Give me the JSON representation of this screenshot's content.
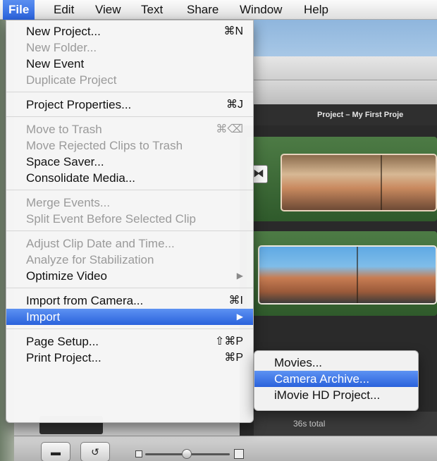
{
  "menubar": {
    "items": [
      "File",
      "Edit",
      "View",
      "Text",
      "Share",
      "Window",
      "Help"
    ],
    "active": "File"
  },
  "file_menu": {
    "groups": [
      [
        {
          "label": "New Project...",
          "shortcut": "⌘N",
          "enabled": true
        },
        {
          "label": "New Folder...",
          "shortcut": "",
          "enabled": false
        },
        {
          "label": "New Event",
          "shortcut": "",
          "enabled": true
        },
        {
          "label": "Duplicate Project",
          "shortcut": "",
          "enabled": false
        }
      ],
      [
        {
          "label": "Project Properties...",
          "shortcut": "⌘J",
          "enabled": true
        }
      ],
      [
        {
          "label": "Move to Trash",
          "shortcut": "⌘⌫",
          "enabled": false
        },
        {
          "label": "Move Rejected Clips to Trash",
          "shortcut": "",
          "enabled": false
        },
        {
          "label": "Space Saver...",
          "shortcut": "",
          "enabled": true
        },
        {
          "label": "Consolidate Media...",
          "shortcut": "",
          "enabled": true
        }
      ],
      [
        {
          "label": "Merge Events...",
          "shortcut": "",
          "enabled": false
        },
        {
          "label": "Split Event Before Selected Clip",
          "shortcut": "",
          "enabled": false
        }
      ],
      [
        {
          "label": "Adjust Clip Date and Time...",
          "shortcut": "",
          "enabled": false
        },
        {
          "label": "Analyze for Stabilization",
          "shortcut": "",
          "enabled": false
        },
        {
          "label": "Optimize Video",
          "shortcut": "",
          "enabled": true,
          "submenu": true
        }
      ],
      [
        {
          "label": "Import from Camera...",
          "shortcut": "⌘I",
          "enabled": true
        },
        {
          "label": "Import",
          "shortcut": "",
          "enabled": true,
          "submenu": true,
          "highlighted": true
        }
      ],
      [
        {
          "label": "Page Setup...",
          "shortcut": "⇧⌘P",
          "enabled": true
        },
        {
          "label": "Print Project...",
          "shortcut": "⌘P",
          "enabled": true
        }
      ]
    ]
  },
  "import_submenu": {
    "items": [
      {
        "label": "Movies...",
        "highlighted": false
      },
      {
        "label": "Camera Archive...",
        "highlighted": true
      },
      {
        "label": "iMovie HD Project...",
        "highlighted": false
      }
    ]
  },
  "background": {
    "project_title": "Project – My First Proje",
    "status_text": "36s total"
  },
  "icons": {
    "submenu_arrow": "▶",
    "transition": "⧓",
    "camera": "▬",
    "rotate": "↺"
  },
  "colors": {
    "highlight": "#2a62dc",
    "menu_bg": "#f6f6f6",
    "disabled_text": "#9a9a9a"
  }
}
